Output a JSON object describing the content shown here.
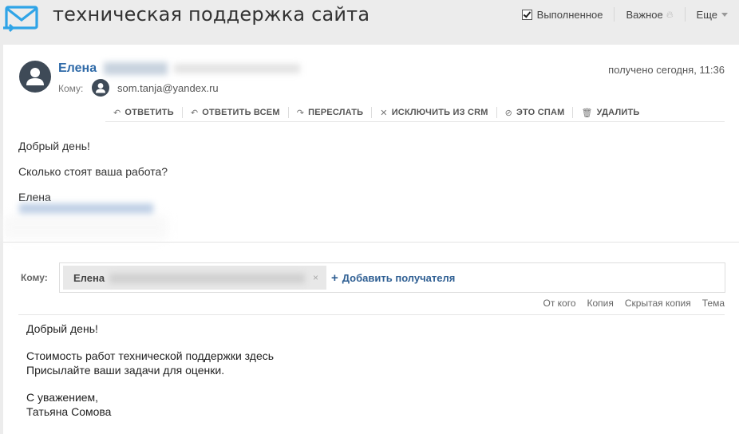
{
  "header": {
    "subject": "техническая поддержка сайта",
    "done_label": "Выполненное",
    "important_label": "Важное",
    "more_label": "Еще"
  },
  "message": {
    "sender_name": "Елена",
    "received": "получено сегодня, 11:36",
    "to_label": "Кому:",
    "to_address": "som.tanja@yandex.ru",
    "actions": [
      {
        "icon": "↶",
        "label": "ОТВЕТИТЬ"
      },
      {
        "icon": "↶",
        "label": "ОТВЕТИТЬ ВСЕМ"
      },
      {
        "icon": "↷",
        "label": "ПЕРЕСЛАТЬ"
      },
      {
        "icon": "✕",
        "label": "ИСКЛЮЧИТЬ ИЗ CRM"
      },
      {
        "icon": "⊘",
        "label": "ЭТО СПАМ"
      },
      {
        "icon": "🗑",
        "label": "УДАЛИТЬ"
      }
    ],
    "body": {
      "greeting": "Добрый день!",
      "question": "Сколько стоят ваша работа?",
      "signature_name": "Елена"
    }
  },
  "compose": {
    "to_label": "Кому:",
    "recipient_name": "Елена",
    "add_recipient": "Добавить получателя",
    "fields": [
      "От кого",
      "Копия",
      "Скрытая копия",
      "Тема"
    ],
    "body": {
      "greeting": "Добрый день!",
      "line1": "Стоимость работ технической поддержки здесь",
      "line2": "Присылайте ваши задачи для оценки.",
      "regards": "С уважением,",
      "name": "Татьяна Сомова"
    }
  },
  "colors": {
    "link_blue": "#2f6aa8",
    "avatar_bg": "#3e4a57",
    "logo_blue": "#2fa4e7"
  }
}
